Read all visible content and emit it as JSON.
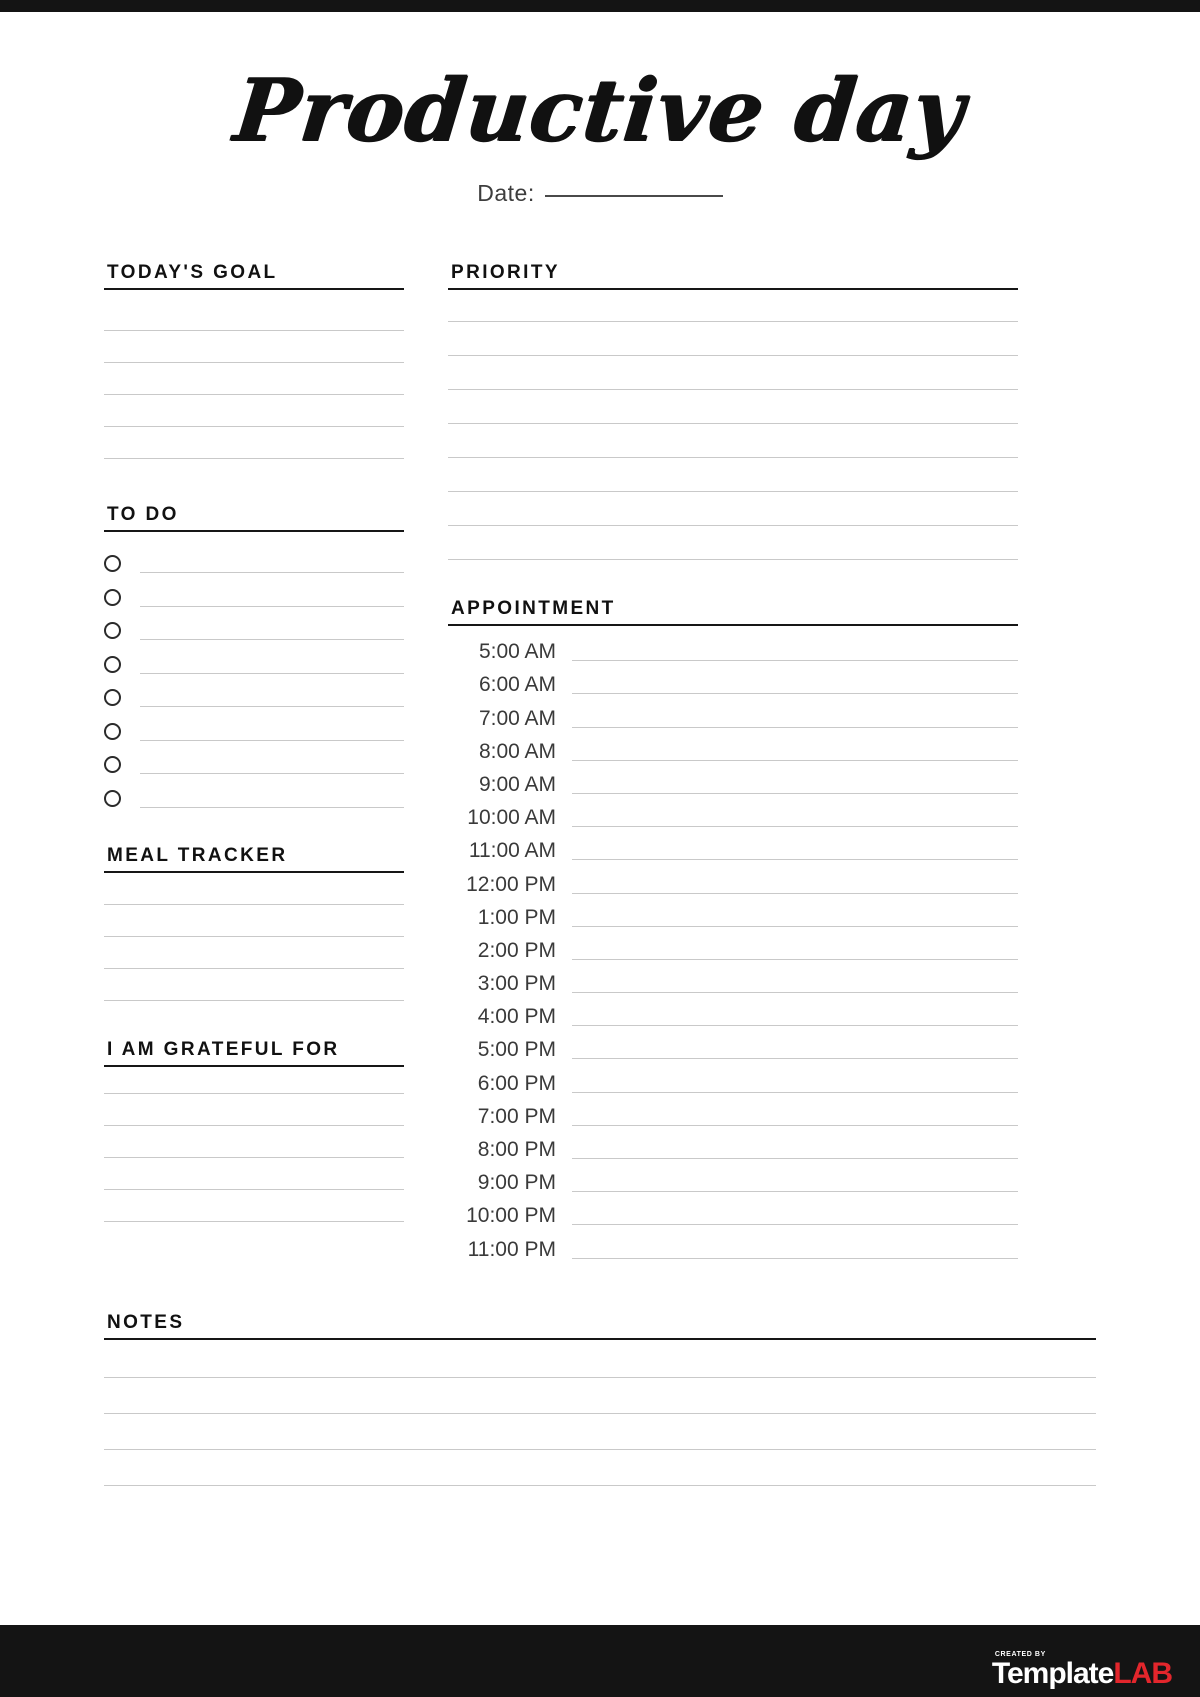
{
  "document": {
    "title": "Productive day",
    "date_label": "Date:",
    "date_value": ""
  },
  "sections": {
    "todays_goal": {
      "heading": "TODAY'S GOAL",
      "line_count": 5
    },
    "to_do": {
      "heading": "TO DO",
      "item_count": 8
    },
    "meal_tracker": {
      "heading": "MEAL TRACKER",
      "line_count": 4
    },
    "grateful": {
      "heading": "I AM GRATEFUL FOR",
      "line_count": 5
    },
    "priority": {
      "heading": "PRIORITY",
      "line_count": 8
    },
    "appointment": {
      "heading": "APPOINTMENT",
      "times": [
        "5:00 AM",
        "6:00 AM",
        "7:00 AM",
        "8:00 AM",
        "9:00 AM",
        "10:00 AM",
        "11:00 AM",
        "12:00 PM",
        "1:00 PM",
        "2:00 PM",
        "3:00 PM",
        "4:00 PM",
        "5:00 PM",
        "6:00 PM",
        "7:00 PM",
        "8:00 PM",
        "9:00 PM",
        "10:00 PM",
        "11:00 PM"
      ]
    },
    "notes": {
      "heading": "NOTES",
      "line_count": 4
    }
  },
  "footer": {
    "logo_kicker": "CREATED BY",
    "logo_name": "Template",
    "logo_accent": "LAB"
  },
  "colors": {
    "frame": "#141414",
    "rule": "#161616",
    "writing_line": "#c9c9c9",
    "time_text": "#3a3a3a",
    "logo_accent": "#e3262c"
  }
}
